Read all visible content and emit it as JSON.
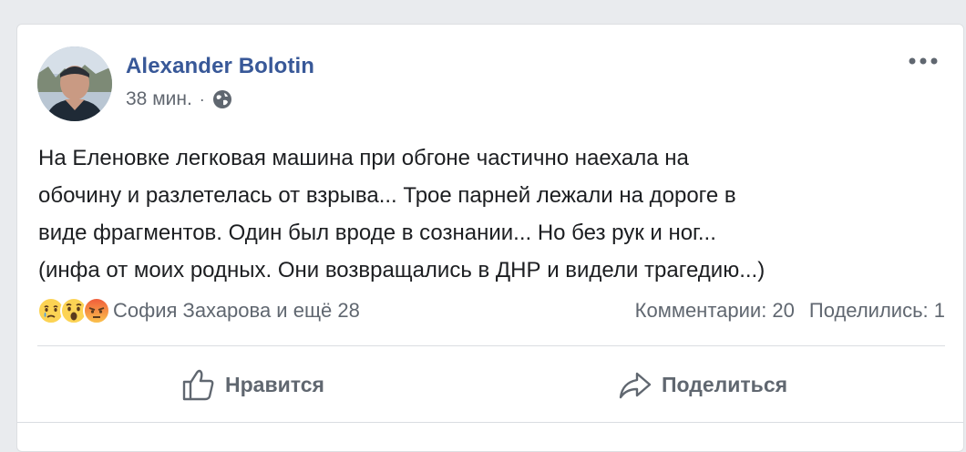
{
  "post": {
    "author": "Alexander Bolotin",
    "time": "38 мин.",
    "separator": "·",
    "privacy_icon": "globe-icon",
    "more_icon": "more-options-icon",
    "text_lines": [
      "На Еленовке легковая машина при обгоне частично наехала на",
      "обочину и разлетелась от взрыва... Трое парней лежали на дороге в",
      "виде фрагментов. Один был вроде в сознании... Но без рук и ног...",
      "(инфа от моих родных. Они возвращались в ДНР и видели трагедию...)"
    ]
  },
  "reactions": {
    "icons": [
      "sad-reaction-icon",
      "wow-reaction-icon",
      "angry-reaction-icon"
    ],
    "summary": "София Захарова и ещё 28",
    "comments": "Комментарии: 20",
    "shares": "Поделились: 1"
  },
  "actions": {
    "like_label": "Нравится",
    "share_label": "Поделиться"
  },
  "colors": {
    "author": "#385898",
    "text": "#1c1e21",
    "secondary": "#606770"
  }
}
